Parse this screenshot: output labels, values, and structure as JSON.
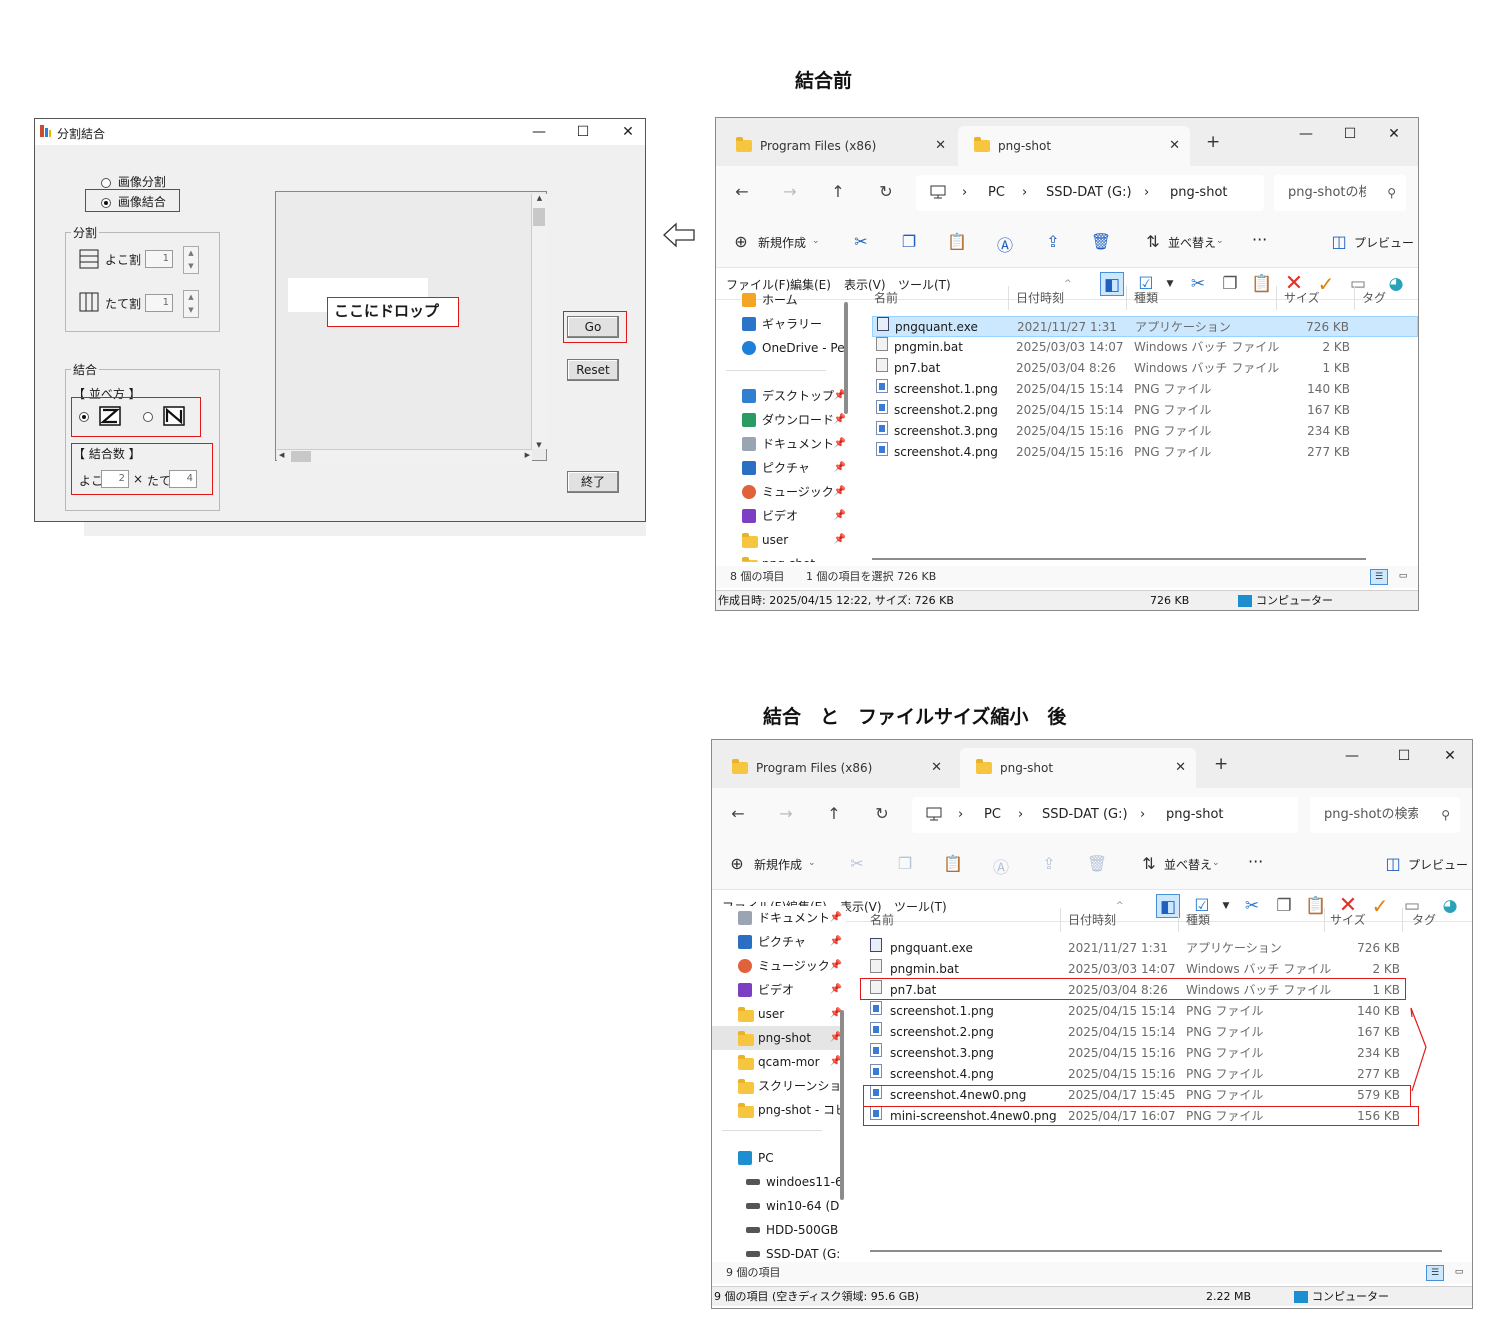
{
  "headings": {
    "before": "結合前",
    "after": "結合　と　ファイルサイズ縮小　後"
  },
  "app": {
    "title": "分割結合",
    "window_buttons": {
      "minimize": "—",
      "maximize": "☐",
      "close": "✕"
    },
    "mode_split": "画像分割",
    "mode_join": "画像結合",
    "mode_selected": "画像結合",
    "split_group": "分割",
    "split_horizontal_label": "よこ割",
    "split_horizontal_value": "1",
    "split_vertical_label": "たて割",
    "split_vertical_value": "1",
    "join_group": "結合",
    "arrange_label": "【 並べ方 】",
    "arrange_selected": "Z",
    "count_label": "【 結合数 】",
    "count_x_label": "よこ",
    "count_x_value": "2",
    "count_times": "×",
    "count_y_label": "たて",
    "count_y_value": "4",
    "drop_label": "ここにドロップ",
    "go_button": "Go",
    "reset_button": "Reset",
    "exit_button": "終了"
  },
  "arrow_icon": "left-arrow-icon",
  "explorer_before": {
    "tabs": [
      "Program Files (x86)",
      "png-shot"
    ],
    "add_tab": "+",
    "breadcrumbs": [
      "PC",
      "SSD-DAT (G:)",
      "png-shot"
    ],
    "search_placeholder": "png-shotの検索",
    "new_button": "新規作成",
    "sort_button": "並べ替え",
    "more_button": "···",
    "preview_button": "プレビュー",
    "menus": [
      "ファイル(F)",
      "編集(E)",
      "表示(V)",
      "ツール(T)"
    ],
    "nav_items": [
      "ホーム",
      "ギャラリー",
      "OneDrive - Pe",
      "デスクトップ",
      "ダウンロード",
      "ドキュメント",
      "ピクチャ",
      "ミュージック",
      "ビデオ",
      "user",
      "png-shot"
    ],
    "columns": [
      "名前",
      "日付時刻",
      "種類",
      "サイズ",
      "タグ"
    ],
    "files": [
      {
        "name": "pngquant.exe",
        "date": "2021/11/27 1:31",
        "type": "アプリケーション",
        "size": "726 KB",
        "icon": "exe",
        "selected": true
      },
      {
        "name": "pngmin.bat",
        "date": "2025/03/03 14:07",
        "type": "Windows バッチ ファイル",
        "size": "2 KB",
        "icon": "bat",
        "selected": false
      },
      {
        "name": "pn7.bat",
        "date": "2025/03/04 8:26",
        "type": "Windows バッチ ファイル",
        "size": "1 KB",
        "icon": "bat",
        "selected": false
      },
      {
        "name": "screenshot.1.png",
        "date": "2025/04/15 15:14",
        "type": "PNG ファイル",
        "size": "140 KB",
        "icon": "png",
        "selected": false
      },
      {
        "name": "screenshot.2.png",
        "date": "2025/04/15 15:14",
        "type": "PNG ファイル",
        "size": "167 KB",
        "icon": "png",
        "selected": false
      },
      {
        "name": "screenshot.3.png",
        "date": "2025/04/15 15:16",
        "type": "PNG ファイル",
        "size": "234 KB",
        "icon": "png",
        "selected": false
      },
      {
        "name": "screenshot.4.png",
        "date": "2025/04/15 15:16",
        "type": "PNG ファイル",
        "size": "277 KB",
        "icon": "png",
        "selected": false
      }
    ],
    "status_count": "8 個の項目",
    "status_selected": "1 個の項目を選択  726 KB",
    "legacy_status": "作成日時: 2025/04/15 12:22, サイズ: 726 KB",
    "legacy_size": "726 KB",
    "legacy_computer": "コンピューター"
  },
  "explorer_after": {
    "tabs": [
      "Program Files (x86)",
      "png-shot"
    ],
    "add_tab": "+",
    "breadcrumbs": [
      "PC",
      "SSD-DAT (G:)",
      "png-shot"
    ],
    "search_placeholder": "png-shotの検索",
    "new_button": "新規作成",
    "sort_button": "並べ替え",
    "more_button": "···",
    "preview_button": "プレビュー",
    "menus": [
      "ファイル(F)",
      "編集(E)",
      "表示(V)",
      "ツール(T)"
    ],
    "nav_items": [
      "ドキュメント",
      "ピクチャ",
      "ミュージック",
      "ビデオ",
      "user",
      "png-shot",
      "qcam-mor",
      "スクリーンショット",
      "png-shot - コピー",
      "PC",
      "windoes11-6",
      "win10-64 (D",
      "HDD-500GB",
      "SSD-DAT (G:"
    ],
    "columns": [
      "名前",
      "日付時刻",
      "種類",
      "サイズ",
      "タグ"
    ],
    "files": [
      {
        "name": "pngquant.exe",
        "date": "2021/11/27 1:31",
        "type": "アプリケーション",
        "size": "726 KB",
        "icon": "exe"
      },
      {
        "name": "pngmin.bat",
        "date": "2025/03/03 14:07",
        "type": "Windows バッチ ファイル",
        "size": "2 KB",
        "icon": "bat"
      },
      {
        "name": "pn7.bat",
        "date": "2025/03/04 8:26",
        "type": "Windows バッチ ファイル",
        "size": "1 KB",
        "icon": "bat"
      },
      {
        "name": "screenshot.1.png",
        "date": "2025/04/15 15:14",
        "type": "PNG ファイル",
        "size": "140 KB",
        "icon": "png"
      },
      {
        "name": "screenshot.2.png",
        "date": "2025/04/15 15:14",
        "type": "PNG ファイル",
        "size": "167 KB",
        "icon": "png"
      },
      {
        "name": "screenshot.3.png",
        "date": "2025/04/15 15:16",
        "type": "PNG ファイル",
        "size": "234 KB",
        "icon": "png"
      },
      {
        "name": "screenshot.4.png",
        "date": "2025/04/15 15:16",
        "type": "PNG ファイル",
        "size": "277 KB",
        "icon": "png"
      },
      {
        "name": "screenshot.4new0.png",
        "date": "2025/04/17 15:45",
        "type": "PNG ファイル",
        "size": "579 KB",
        "icon": "png"
      },
      {
        "name": "mini-screenshot.4new0.png",
        "date": "2025/04/17 16:07",
        "type": "PNG ファイル",
        "size": "156 KB",
        "icon": "png"
      }
    ],
    "status_count": "9 個の項目",
    "legacy_status": "9 個の項目 (空きディスク領域: 95.6 GB)",
    "legacy_size": "2.22 MB",
    "legacy_computer": "コンピューター"
  },
  "colors": {
    "highlight_red": "#e01818",
    "selection_blue": "#cce8ff",
    "accent_blue": "#1f5fbf"
  }
}
